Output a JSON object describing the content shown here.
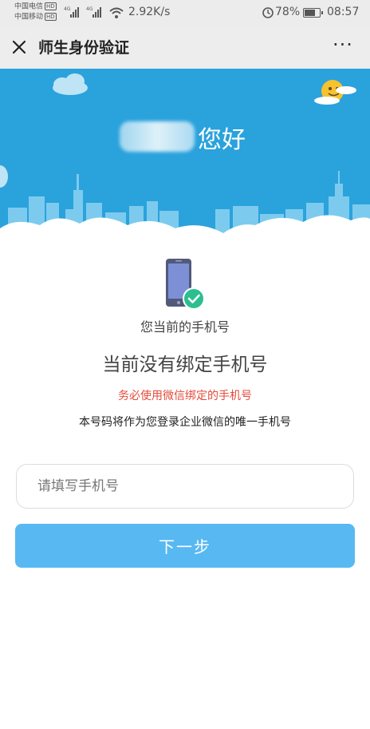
{
  "status_bar": {
    "carrier_1": "中国电信",
    "carrier_2": "中国移动",
    "hd_badge": "HD",
    "net_type": "4G",
    "net_speed": "2.92K/s",
    "battery_text": "78%",
    "battery_level": 0.78,
    "time": "08:57"
  },
  "nav": {
    "title": "师生身份验证",
    "more_label": "···"
  },
  "banner": {
    "greeting": "您好"
  },
  "content": {
    "current_phone_label": "您当前的手机号",
    "no_phone_text": "当前没有绑定手机号",
    "warning_text": "务必使用微信绑定的手机号",
    "info_text": "本号码将作为您登录企业微信的唯一手机号"
  },
  "form": {
    "phone_placeholder": "请填写手机号",
    "phone_value": "",
    "next_label": "下一步"
  },
  "colors": {
    "banner_blue": "#2aa2dc",
    "button_blue": "#58b8f2",
    "warning_red": "#e54b3c",
    "check_green": "#2bbf8f"
  }
}
